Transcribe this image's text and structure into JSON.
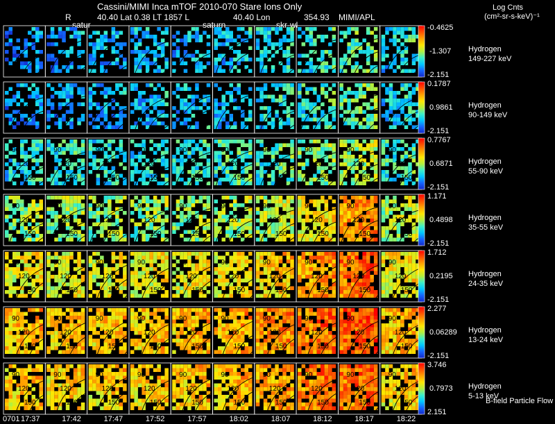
{
  "header": {
    "title": "Cassini/MIMI Inca mTOF  2010-070   Stare    Ions Only",
    "r_label": "R",
    "lat_label": "40.40 Lat 0.38 LT 1857 L",
    "lon_label": "40.40 Lon",
    "lon_value": "354.93",
    "org": "MIMI/APL",
    "units_line1": "Log Cnts",
    "units_line2": "(cm²-sr-s-keV)⁻¹",
    "target_labels": [
      "satur",
      "saturn",
      "skr-wl"
    ]
  },
  "chart_data": {
    "type": "heatmap",
    "title": "Cassini/MIMI Inca mTOF  2010-070   Stare    Ions Only",
    "x_tick_labels": [
      "0701",
      "17:37",
      "17:42",
      "17:47",
      "17:52",
      "17:57",
      "18:02",
      "18:07",
      "18:12",
      "18:17",
      "18:22"
    ],
    "panels_per_row": 10,
    "contour_labels": [
      "90",
      "120",
      "150"
    ],
    "colorscale": [
      "#1428c8",
      "#1464ff",
      "#00c8ff",
      "#3cf0c8",
      "#b4f03c",
      "#ffe600",
      "#ffa000",
      "#ff5000",
      "#ff0000"
    ],
    "rows": [
      {
        "species": "Hydrogen",
        "energy": "149-227 keV",
        "max": "-0.4625",
        "mid": "-1.307",
        "min": "-2.151",
        "level": [
          0.15,
          0.18,
          0.22,
          0.25,
          0.22,
          0.25,
          0.28,
          0.32,
          0.38,
          0.3
        ]
      },
      {
        "species": "Hydrogen",
        "energy": "90-149 keV",
        "max": "0.1787",
        "mid": "0.9861",
        "min": "-2.151",
        "level": [
          0.18,
          0.2,
          0.2,
          0.22,
          0.25,
          0.25,
          0.3,
          0.32,
          0.4,
          0.28
        ]
      },
      {
        "species": "Hydrogen",
        "energy": "55-90 keV",
        "max": "0.7767",
        "mid": "0.6871",
        "min": "-2.151",
        "level": [
          0.3,
          0.32,
          0.3,
          0.3,
          0.32,
          0.35,
          0.36,
          0.42,
          0.48,
          0.35
        ]
      },
      {
        "species": "Hydrogen",
        "energy": "35-55 keV",
        "max": "1.171",
        "mid": "0.4898",
        "min": "-2.151",
        "level": [
          0.45,
          0.45,
          0.44,
          0.45,
          0.45,
          0.47,
          0.5,
          0.6,
          0.75,
          0.5
        ]
      },
      {
        "species": "Hydrogen",
        "energy": "24-35 keV",
        "max": "1.712",
        "mid": "0.2195",
        "min": "-2.151",
        "level": [
          0.58,
          0.56,
          0.55,
          0.56,
          0.58,
          0.6,
          0.65,
          0.72,
          0.82,
          0.6
        ]
      },
      {
        "species": "Hydrogen",
        "energy": "13-24 keV",
        "max": "2.277",
        "mid": "0.06289",
        "min": "-2.151",
        "level": [
          0.68,
          0.66,
          0.66,
          0.66,
          0.68,
          0.7,
          0.74,
          0.8,
          0.85,
          0.68
        ]
      },
      {
        "species": "Hydrogen",
        "energy": "5-13 keV",
        "max": "3.746",
        "mid": "0.7973",
        "min": "2.151",
        "level": [
          0.66,
          0.64,
          0.64,
          0.64,
          0.66,
          0.68,
          0.72,
          0.78,
          0.82,
          0.64
        ]
      }
    ],
    "footnote": "B-field Particle Flow"
  }
}
